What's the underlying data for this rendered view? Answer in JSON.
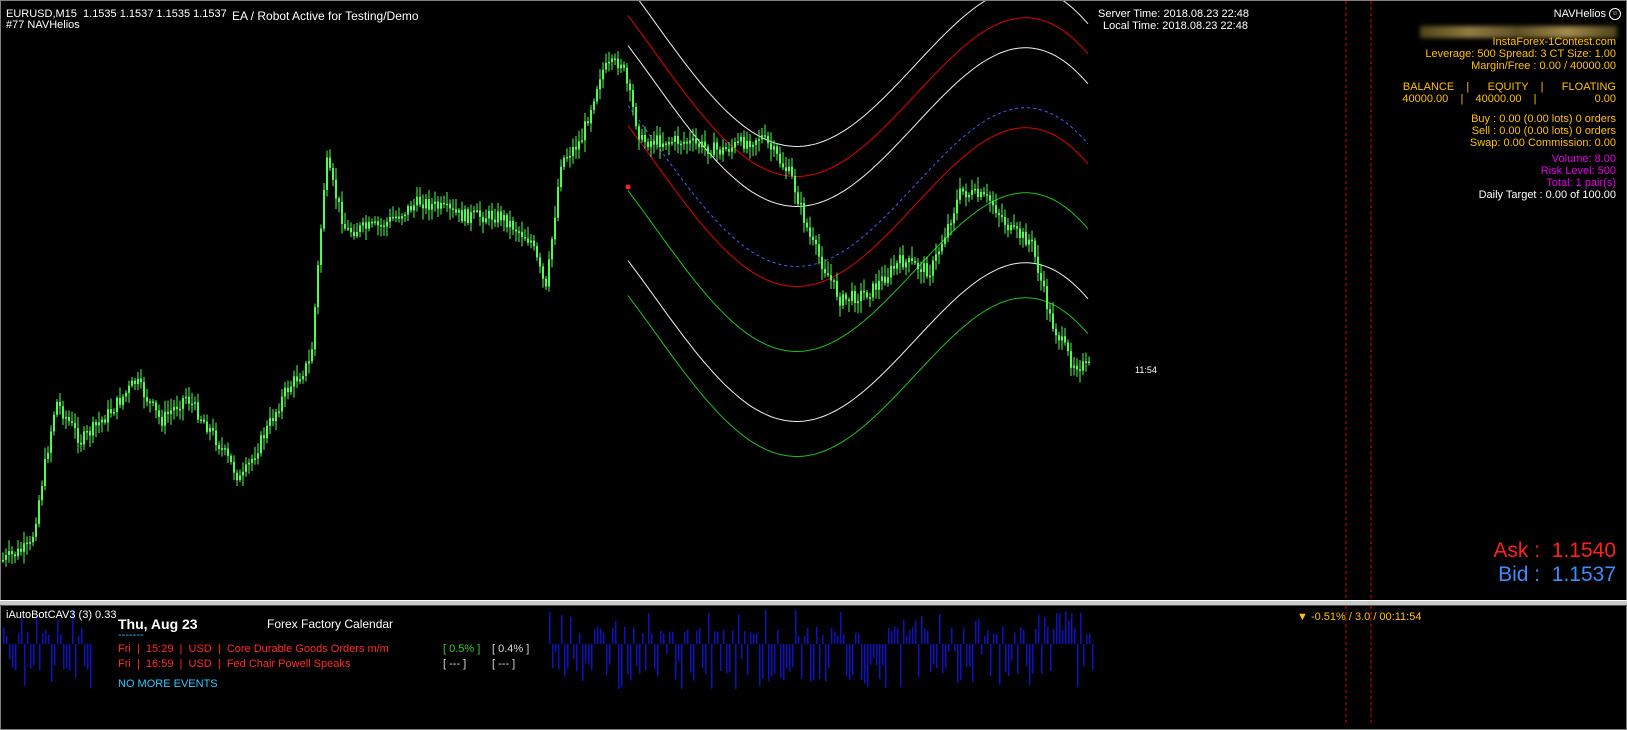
{
  "header": {
    "symbol_line": "EURUSD,M15  1.1535 1.1537 1.1535 1.1537",
    "account_line": "#77 NAVHelios",
    "ea_status": "EA / Robot Active for Testing/Demo",
    "server_time": "Server Time: 2018.08.23 22:48",
    "local_time": "Local Time: 2018.08.23 22:48",
    "brand": "NAVHelios",
    "brand_icon": "smiley-icon"
  },
  "account_panel": {
    "broker": "InstaForex-1Contest.com",
    "leverage_line": "Leverage: 500 Spread: 3 CT Size: 1.00",
    "margin_line": "Margin/Free : 0.00 / 40000.00",
    "balance_header": "BALANCE    |      EQUITY    |      FLOATING",
    "balance_values": "40000.00    |    40000.00    |                   0.00",
    "buy_line": "Buy : 0.00 (0.00 lots) 0 orders",
    "sell_line": "Sell : 0.00 (0.00 lots) 0 orders",
    "swap_line": "Swap: 0.00 Commission: 0.00",
    "volume_line": "Volume: 8.00",
    "risk_line": "Risk Level: 500",
    "total_line": "Total: 1 pair(s)",
    "target_line": "Daily Target : 0.00 of 100.00"
  },
  "prices": {
    "ask": "Ask :  1.1540",
    "bid": "Bid :  1.1537",
    "bar_timer": "11:54"
  },
  "indicator": {
    "name": "iAutoBotCAV3 (3) 0.33",
    "info": "-0.51% / 3.0 / 00:11:54",
    "info_icon": "triangle-down-icon"
  },
  "calendar": {
    "date": "Thu, Aug 23",
    "title": "Forex Factory Calendar",
    "dash": "-------",
    "events": [
      {
        "text": "Fri  |  15:29  |  USD  |  Core Durable Goods Orders m/m",
        "forecast": "[ 0.5% ]",
        "previous": "[ 0.4% ]"
      },
      {
        "text": "Fri  |  16:59  |  USD  |  Fed Chair Powell Speaks",
        "forecast": "[ --- ]",
        "previous": "[ --- ]"
      }
    ],
    "footer": "NO MORE EVENTS"
  },
  "colors": {
    "candles": "#4cff4c",
    "band_red": "#e00000",
    "band_white": "#f0f0f0",
    "band_green": "#20c020",
    "midline": "#4060ff",
    "histogram": "#1010c0",
    "grid_marker": "#e00000"
  },
  "chart_data": {
    "type": "candlestick",
    "symbol": "EURUSD",
    "timeframe": "M15",
    "last_ohlc": {
      "open": 1.1535,
      "high": 1.1537,
      "low": 1.1535,
      "close": 1.1537
    },
    "ask": 1.154,
    "bid": 1.1537
  }
}
